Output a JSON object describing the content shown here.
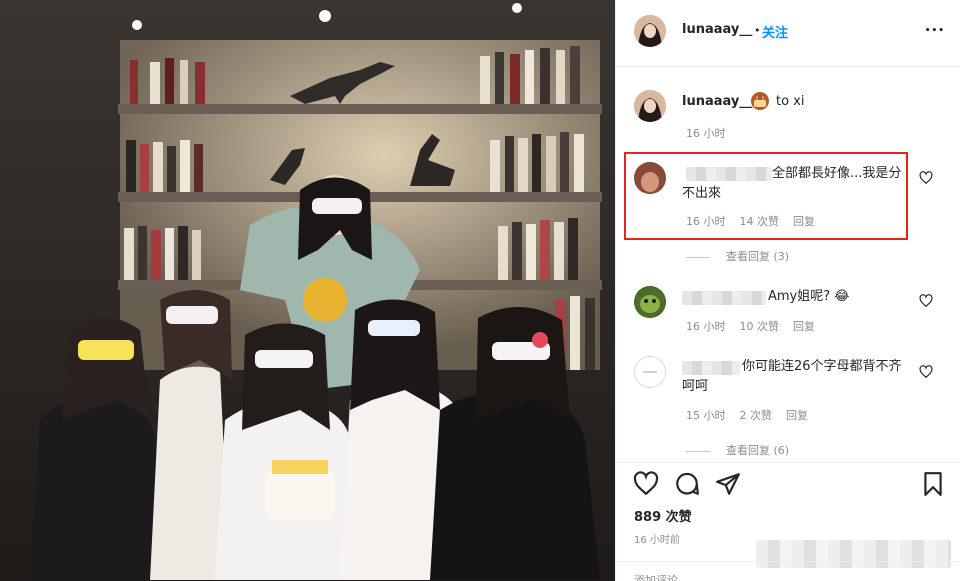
{
  "header": {
    "username": "lunaaay__",
    "separator": "•",
    "follow": "关注",
    "more": "•••"
  },
  "caption": {
    "username": "lunaaay__",
    "text": "to xi",
    "time": "16 小时"
  },
  "comments": [
    {
      "text": "全部都長好像...我是分不出來",
      "time": "16 小时",
      "likes": "14 次赞",
      "reply": "回复",
      "view_replies": "查看回复 (3)"
    },
    {
      "text": "Amy姐呢? 😂",
      "time": "16 小时",
      "likes": "10 次赞",
      "reply": "回复"
    },
    {
      "text": "你可能连26个字母都背不齐 呵呵",
      "time": "15 小时",
      "likes": "2 次赞",
      "reply": "回复",
      "view_replies": "查看回复 (6)"
    }
  ],
  "post": {
    "likes": "889 次赞",
    "ago": "16 小时前",
    "add_comment": "添加评论..."
  },
  "icons": [
    "heart-icon",
    "comment-icon",
    "share-icon",
    "bookmark-icon"
  ],
  "colors": {
    "accent": "#0095f6",
    "highlight_border": "#e3241d",
    "text": "#262626",
    "muted": "#8e8e8e"
  }
}
